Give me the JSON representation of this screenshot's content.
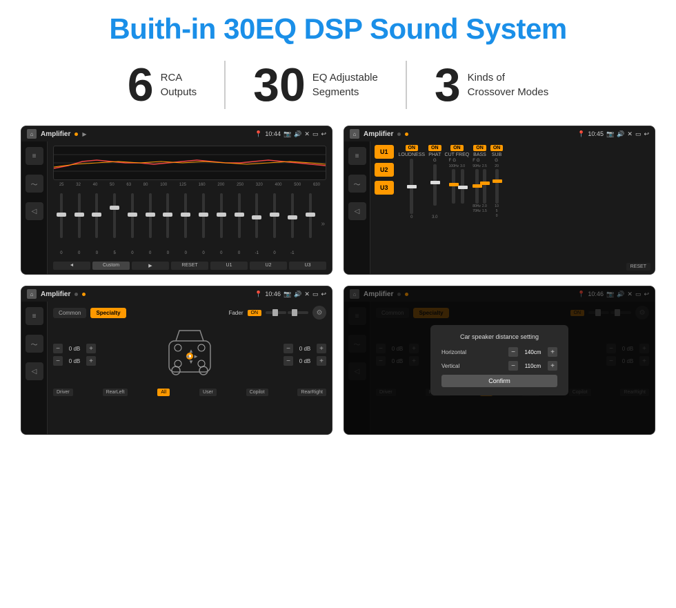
{
  "page": {
    "title": "Buith-in 30EQ DSP Sound System",
    "title_color": "#1a8fe8"
  },
  "features": [
    {
      "number": "6",
      "label_line1": "RCA",
      "label_line2": "Outputs"
    },
    {
      "number": "30",
      "label_line1": "EQ Adjustable",
      "label_line2": "Segments"
    },
    {
      "number": "3",
      "label_line1": "Kinds of",
      "label_line2": "Crossover Modes"
    }
  ],
  "screens": [
    {
      "id": "eq-screen",
      "status_time": "10:44",
      "app_title": "Amplifier",
      "description": "30-band EQ screen with custom sliders"
    },
    {
      "id": "crossover-screen",
      "status_time": "10:45",
      "app_title": "Amplifier",
      "description": "3-mode crossover screen U1/U2/U3"
    },
    {
      "id": "fader-screen",
      "status_time": "10:46",
      "app_title": "Amplifier",
      "description": "Car speaker fader/balance screen"
    },
    {
      "id": "dialog-screen",
      "status_time": "10:46",
      "app_title": "Amplifier",
      "description": "Car speaker distance setting dialog",
      "dialog": {
        "title": "Car speaker distance setting",
        "horizontal_label": "Horizontal",
        "horizontal_value": "140cm",
        "vertical_label": "Vertical",
        "vertical_value": "110cm",
        "confirm_label": "Confirm"
      }
    }
  ],
  "eq_bands": [
    "25",
    "32",
    "40",
    "50",
    "63",
    "80",
    "100",
    "125",
    "160",
    "200",
    "250",
    "320",
    "400",
    "500",
    "630"
  ],
  "eq_values": [
    "0",
    "0",
    "0",
    "5",
    "0",
    "0",
    "0",
    "0",
    "0",
    "0",
    "0",
    "-1",
    "0",
    "-1",
    ""
  ],
  "crossover_modes": [
    "U1",
    "U2",
    "U3"
  ],
  "crossover_sections": [
    {
      "on": true,
      "label": "LOUDNESS"
    },
    {
      "on": true,
      "label": "PHAT"
    },
    {
      "on": true,
      "label": "CUT FREQ"
    },
    {
      "on": true,
      "label": "BASS"
    },
    {
      "on": true,
      "label": "SUB"
    }
  ],
  "fader_tabs": [
    "Common",
    "Specialty"
  ],
  "fader_active_tab": "Specialty",
  "fader_label": "Fader",
  "fader_on": "ON",
  "db_values": [
    "0 dB",
    "0 dB",
    "0 dB",
    "0 dB"
  ],
  "bottom_labels": [
    "Driver",
    "Copilot",
    "RearLeft",
    "All",
    "User",
    "RearRight"
  ],
  "all_active": true
}
